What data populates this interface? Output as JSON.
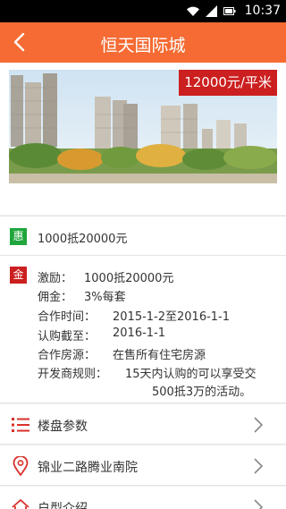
{
  "status_bar": {
    "time": "10:37"
  },
  "header": {
    "title": "恒天国际城"
  },
  "hero": {
    "price_badge": "12000元/平米"
  },
  "promo": {
    "tag": "惠",
    "text": "1000抵20000元"
  },
  "details": {
    "tag": "金",
    "rows": [
      {
        "label": "激励：",
        "value": "1000抵20000元"
      },
      {
        "label": "佣金：",
        "value": "3%每套"
      },
      {
        "label": "合作时间：",
        "value": "2015-1-2至2016-1-1"
      },
      {
        "label": "认购截至：",
        "value": "2016-1-1"
      },
      {
        "label": "合作房源：",
        "value": "在售所有住宅房源"
      },
      {
        "label": "开发商规则：",
        "value": "15天内认购的可以享受交",
        "continuation": "500抵3万的活动。"
      }
    ]
  },
  "menu": [
    {
      "label": "楼盘参数",
      "icon": "list-icon"
    },
    {
      "label": "锦业二路腾业南院",
      "icon": "location-pin-icon"
    },
    {
      "label": "户型介绍",
      "icon": "house-icon"
    }
  ],
  "colors": {
    "appbar": "#f56b33",
    "price_badge": "#cc1f1f",
    "promo_tag": "#20a63c",
    "detail_tag": "#cc1f1f",
    "menu_icon": "#d9312b"
  }
}
